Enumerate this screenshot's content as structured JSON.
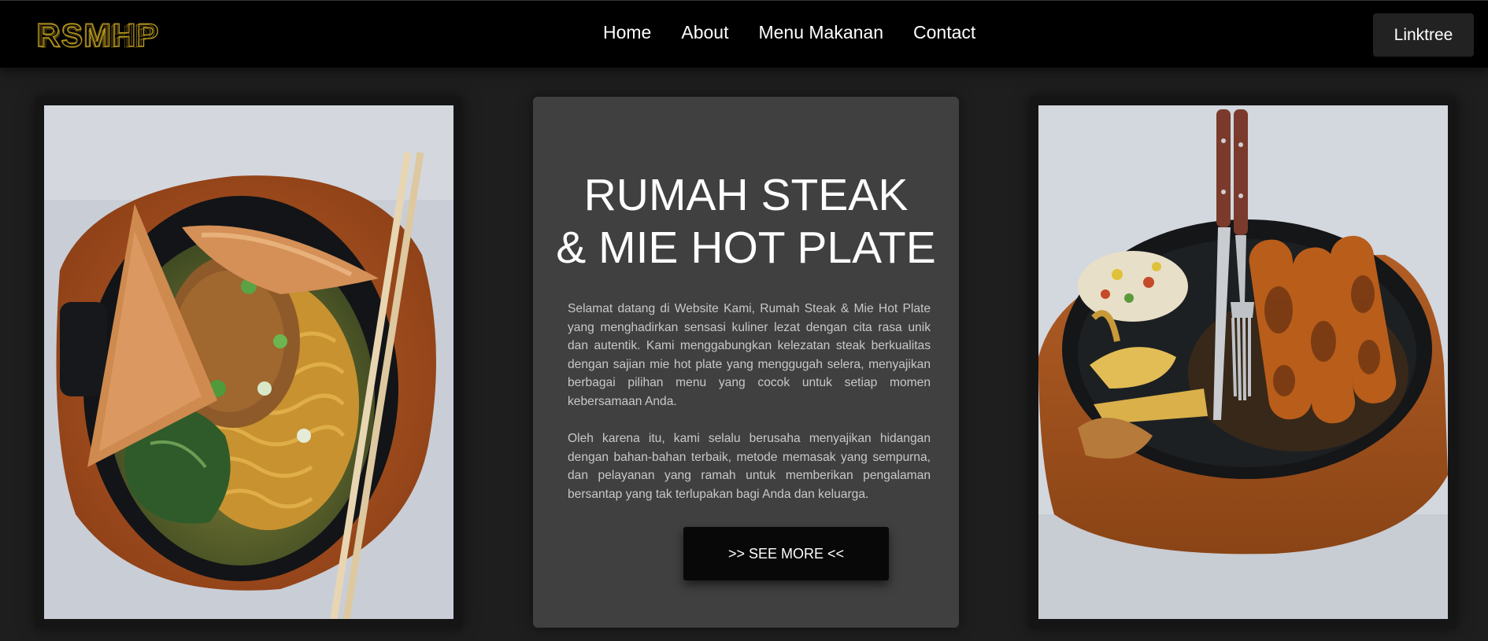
{
  "brand": {
    "logo_text": "RSMHP",
    "logo_color": "#b8971f"
  },
  "nav": {
    "items": [
      {
        "label": "Home"
      },
      {
        "label": "About"
      },
      {
        "label": "Menu Makanan"
      },
      {
        "label": "Contact"
      }
    ],
    "linktree_label": "Linktree"
  },
  "hero": {
    "title_line1": "RUMAH STEAK",
    "title_line2": "& MIE HOT PLATE",
    "paragraph1": "Selamat datang di Website Kami, Rumah Steak & Mie Hot Plate yang menghadirkan sensasi kuliner lezat dengan cita rasa unik dan autentik. Kami menggabungkan kelezatan steak berkualitas dengan sajian mie hot plate yang menggugah selera, menyajikan berbagai pilihan menu yang cocok untuk setiap momen kebersamaan Anda.",
    "paragraph2": "Oleh karena itu, kami selalu berusaha menyajikan hidangan dengan bahan-bahan terbaik, metode memasak yang sempurna, dan pelayanan yang ramah untuk memberikan pengalaman bersantap yang tak terlupakan bagi Anda dan keluarga.",
    "button_label": ">> SEE MORE <<"
  },
  "colors": {
    "page_bg": "#1e1e1e",
    "navbar_bg": "#000000",
    "card_bg": "#404040",
    "button_bg": "#080808",
    "linktree_bg": "#222222"
  }
}
